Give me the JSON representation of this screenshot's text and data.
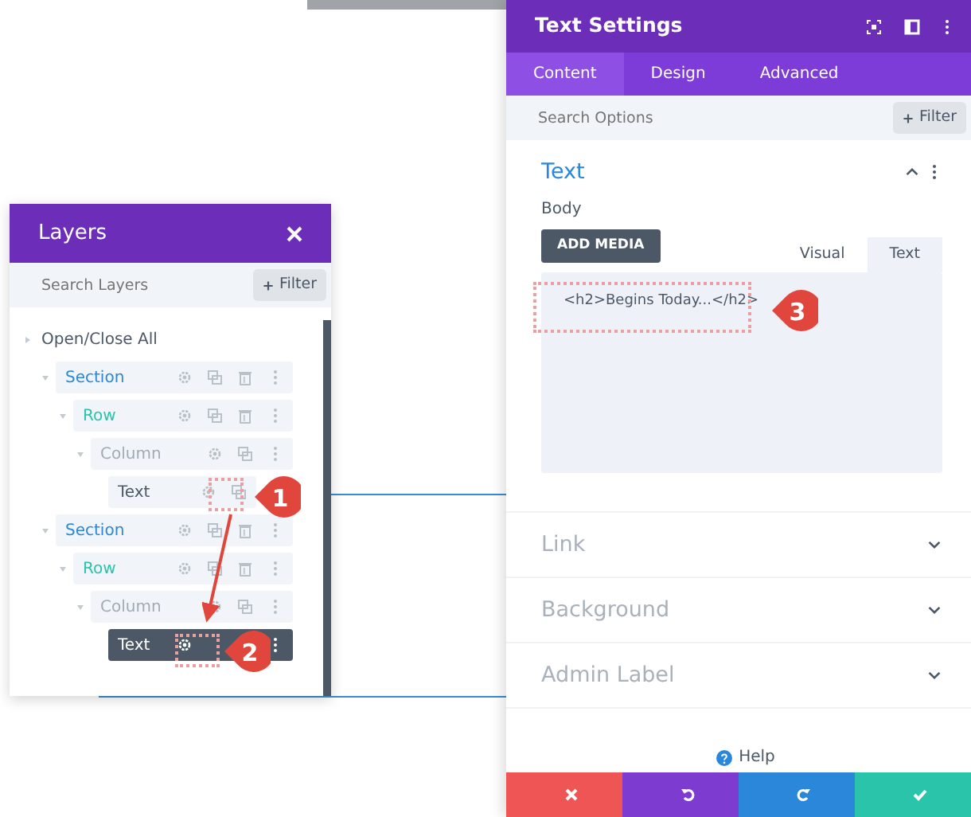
{
  "layers": {
    "title": "Layers",
    "search": {
      "placeholder": "Search Layers"
    },
    "filter": "Filter",
    "toggle_all": "Open/Close All",
    "tree": [
      {
        "label": "Section",
        "kind": "section",
        "expanded": true,
        "selected": false,
        "children": [
          {
            "label": "Row",
            "kind": "row",
            "expanded": true,
            "selected": false,
            "children": [
              {
                "label": "Column",
                "kind": "column",
                "expanded": true,
                "selected": false,
                "children": [
                  {
                    "label": "Text",
                    "kind": "text",
                    "selected": false
                  }
                ]
              }
            ]
          }
        ]
      },
      {
        "label": "Section",
        "kind": "section",
        "expanded": true,
        "selected": false,
        "children": [
          {
            "label": "Row",
            "kind": "row",
            "expanded": true,
            "selected": false,
            "children": [
              {
                "label": "Column",
                "kind": "column",
                "expanded": true,
                "selected": false,
                "children": [
                  {
                    "label": "Text",
                    "kind": "text",
                    "selected": true
                  }
                ]
              }
            ]
          }
        ]
      }
    ]
  },
  "settings": {
    "title": "Text Settings",
    "tabs": [
      {
        "label": "Content",
        "selected": true
      },
      {
        "label": "Design",
        "selected": false
      },
      {
        "label": "Advanced",
        "selected": false
      }
    ],
    "search": {
      "placeholder": "Search Options"
    },
    "filter": "Filter",
    "sections": [
      {
        "title": "Text",
        "expanded": true,
        "field_label": "Body",
        "add_media": "ADD MEDIA",
        "editor_tabs": [
          {
            "label": "Visual",
            "selected": false
          },
          {
            "label": "Text",
            "selected": true
          }
        ],
        "editor_value": "<h2>Begins Today...</h2>"
      },
      {
        "title": "Link",
        "expanded": false
      },
      {
        "title": "Background",
        "expanded": false
      },
      {
        "title": "Admin Label",
        "expanded": false
      }
    ],
    "help": "Help",
    "actions": [
      {
        "kind": "cancel"
      },
      {
        "kind": "undo"
      },
      {
        "kind": "redo"
      },
      {
        "kind": "save"
      }
    ]
  },
  "annotations": [
    {
      "number": "1"
    },
    {
      "number": "2"
    },
    {
      "number": "3"
    }
  ]
}
